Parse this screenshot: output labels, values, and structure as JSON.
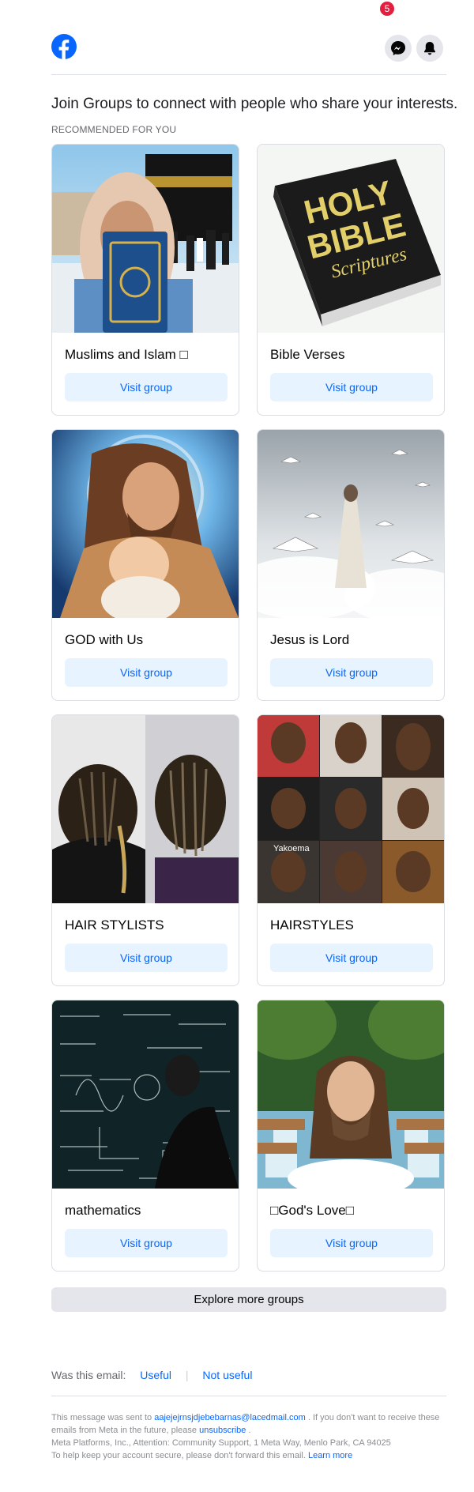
{
  "header": {
    "notification_count": "5"
  },
  "headline": "Join Groups to connect with people who share your interests.",
  "section_label": "RECOMMENDED FOR YOU",
  "groups": [
    {
      "name": "Muslims and Islam □",
      "button": "Visit group"
    },
    {
      "name": "Bible Verses",
      "button": "Visit group"
    },
    {
      "name": "GOD with Us",
      "button": "Visit group"
    },
    {
      "name": "Jesus is Lord",
      "button": "Visit group"
    },
    {
      "name": "HAIR STYLISTS",
      "button": "Visit group"
    },
    {
      "name": "HAIRSTYLES",
      "button": "Visit group"
    },
    {
      "name": "mathematics",
      "button": "Visit group"
    },
    {
      "name": "□God's Love□",
      "button": "Visit group"
    }
  ],
  "images": {
    "bible_line1": "HOLY",
    "bible_line2": "BIBLE",
    "bible_line3": "Scriptures",
    "hair_watermark": "Yakoema"
  },
  "explore_button": "Explore more groups",
  "feedback": {
    "question": "Was this email:",
    "useful": "Useful",
    "not_useful": "Not useful"
  },
  "footer": {
    "sent_to_prefix": "This message was sent to",
    "email": "aajejejrnsjdjebebarnas@lacedmail.com",
    "sent_to_suffix": ". If you don't want to receive these emails from Meta in the future, please",
    "unsubscribe": "unsubscribe",
    "period": ".",
    "address": "Meta Platforms, Inc., Attention: Community Support, 1 Meta Way, Menlo Park, CA 94025",
    "security_note": "To help keep your account secure, please don't forward this email.",
    "learn_more": "Learn more"
  },
  "colors": {
    "brand_blue": "#0866ff",
    "badge_red": "#e41e3f",
    "button_bg": "#e7f3ff"
  }
}
